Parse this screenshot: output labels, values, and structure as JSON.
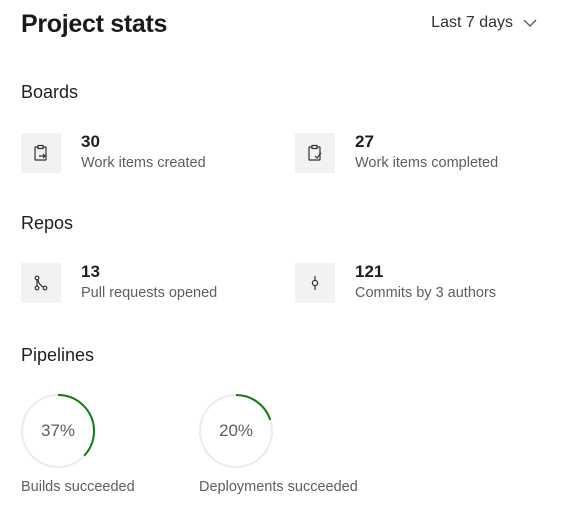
{
  "header": {
    "title": "Project stats",
    "range_label": "Last 7 days"
  },
  "boards": {
    "heading": "Boards",
    "items": [
      {
        "value": "30",
        "label": "Work items created",
        "icon": "work-item-created-icon"
      },
      {
        "value": "27",
        "label": "Work items completed",
        "icon": "work-item-completed-icon"
      }
    ]
  },
  "repos": {
    "heading": "Repos",
    "items": [
      {
        "value": "13",
        "label": "Pull requests opened",
        "icon": "pull-request-icon"
      },
      {
        "value": "121",
        "label": "Commits by 3 authors",
        "icon": "commit-icon"
      }
    ]
  },
  "pipelines": {
    "heading": "Pipelines",
    "items": [
      {
        "percent": 37,
        "display": "37%",
        "label": "Builds succeeded"
      },
      {
        "percent": 20,
        "display": "20%",
        "label": "Deployments succeeded"
      }
    ],
    "ring_color": "#107c10",
    "track_color": "#edebe9"
  }
}
